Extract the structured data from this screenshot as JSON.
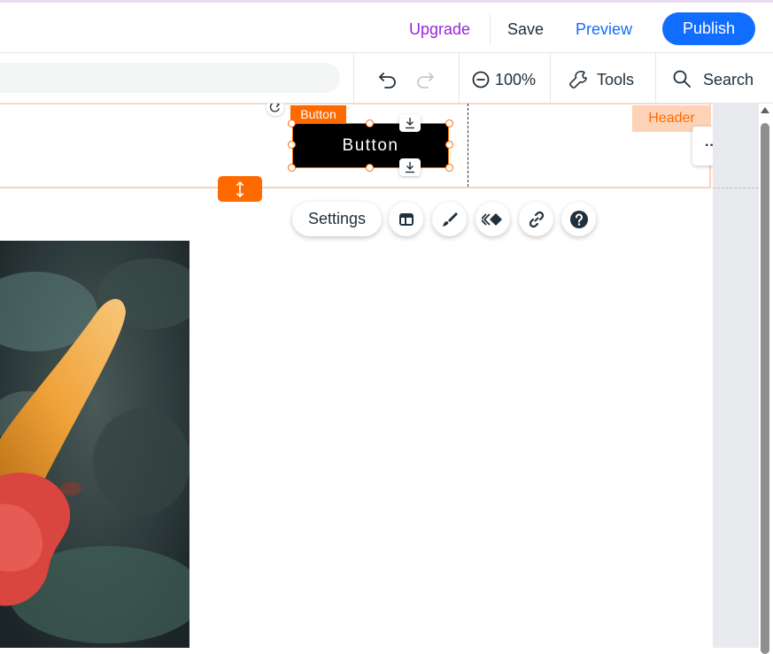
{
  "topbar": {
    "upgrade_label": "Upgrade",
    "save_label": "Save",
    "preview_label": "Preview",
    "publish_label": "Publish"
  },
  "toolbar": {
    "zoom_label": "100%",
    "tools_label": "Tools",
    "search_label": "Search"
  },
  "canvas": {
    "header_tag": "Header",
    "header_more": "···",
    "element_label": "Button",
    "button_text": "Button",
    "settings_label": "Settings"
  },
  "colors": {
    "accent": "#116dff",
    "upgrade": "#9a27d5",
    "selection": "#ff6a00",
    "header_highlight": "#fdd3b8"
  },
  "icons": [
    "undo-icon",
    "redo-icon",
    "zoom-out-icon",
    "tools-icon",
    "search-icon",
    "rotate-icon",
    "anchor-icon",
    "stretch-icon",
    "layout-icon",
    "design-brush-icon",
    "animation-icon",
    "link-icon",
    "help-icon",
    "more-icon"
  ]
}
